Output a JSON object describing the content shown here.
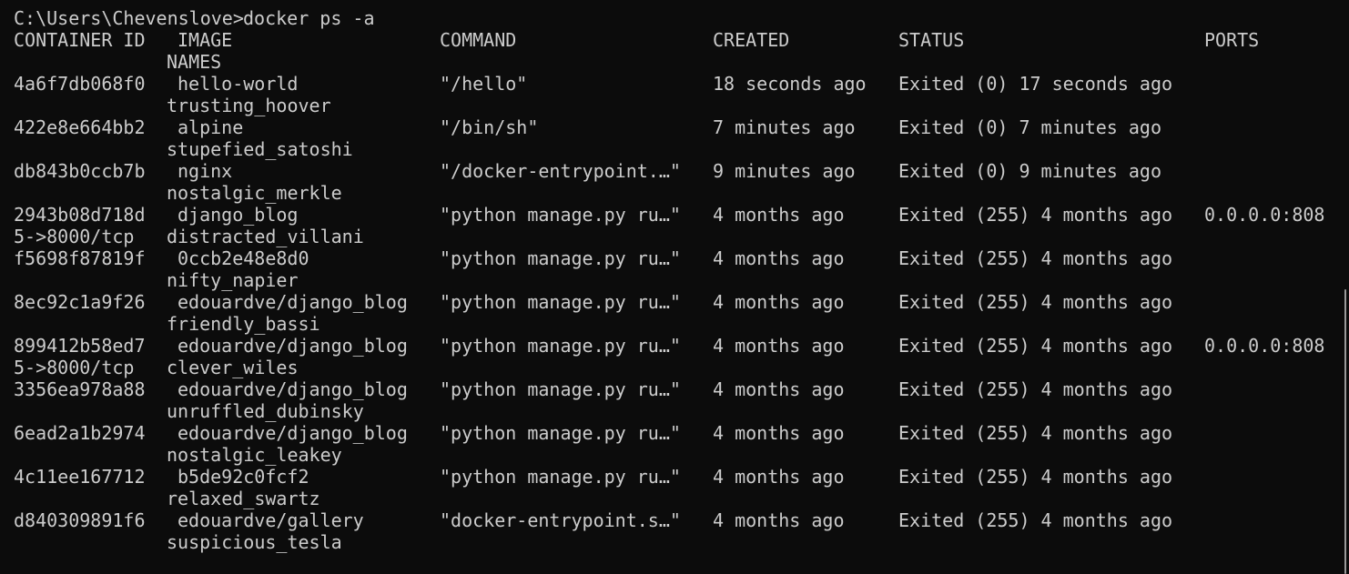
{
  "prompt": {
    "path": "C:\\Users\\Chevenslove>",
    "command": "docker ps -a"
  },
  "headers": {
    "container_id": "CONTAINER ID",
    "image": "IMAGE",
    "command": "COMMAND",
    "created": "CREATED",
    "status": "STATUS",
    "ports": "PORTS",
    "names": "NAMES"
  },
  "rows": [
    {
      "id": "4a6f7db068f0",
      "image": "hello-world",
      "command": "\"/hello\"",
      "created": "18 seconds ago",
      "status": "Exited (0) 17 seconds ago",
      "ports": "",
      "ports_wrap": "",
      "name": "trusting_hoover"
    },
    {
      "id": "422e8e664bb2",
      "image": "alpine",
      "command": "\"/bin/sh\"",
      "created": "7 minutes ago",
      "status": "Exited (0) 7 minutes ago",
      "ports": "",
      "ports_wrap": "",
      "name": "stupefied_satoshi"
    },
    {
      "id": "db843b0ccb7b",
      "image": "nginx",
      "command": "\"/docker-entrypoint.…\"",
      "created": "9 minutes ago",
      "status": "Exited (0) 9 minutes ago",
      "ports": "",
      "ports_wrap": "",
      "name": "nostalgic_merkle"
    },
    {
      "id": "2943b08d718d",
      "image": "django_blog",
      "command": "\"python manage.py ru…\"",
      "created": "4 months ago",
      "status": "Exited (255) 4 months ago",
      "ports": "0.0.0.0:808",
      "ports_wrap": "5->8000/tcp",
      "name": "distracted_villani"
    },
    {
      "id": "f5698f87819f",
      "image": "0ccb2e48e8d0",
      "command": "\"python manage.py ru…\"",
      "created": "4 months ago",
      "status": "Exited (255) 4 months ago",
      "ports": "",
      "ports_wrap": "",
      "name": "nifty_napier"
    },
    {
      "id": "8ec92c1a9f26",
      "image": "edouardve/django_blog",
      "command": "\"python manage.py ru…\"",
      "created": "4 months ago",
      "status": "Exited (255) 4 months ago",
      "ports": "",
      "ports_wrap": "",
      "name": "friendly_bassi"
    },
    {
      "id": "899412b58ed7",
      "image": "edouardve/django_blog",
      "command": "\"python manage.py ru…\"",
      "created": "4 months ago",
      "status": "Exited (255) 4 months ago",
      "ports": "0.0.0.0:808",
      "ports_wrap": "5->8000/tcp",
      "name": "clever_wiles"
    },
    {
      "id": "3356ea978a88",
      "image": "edouardve/django_blog",
      "command": "\"python manage.py ru…\"",
      "created": "4 months ago",
      "status": "Exited (255) 4 months ago",
      "ports": "",
      "ports_wrap": "",
      "name": "unruffled_dubinsky"
    },
    {
      "id": "6ead2a1b2974",
      "image": "edouardve/django_blog",
      "command": "\"python manage.py ru…\"",
      "created": "4 months ago",
      "status": "Exited (255) 4 months ago",
      "ports": "",
      "ports_wrap": "",
      "name": "nostalgic_leakey"
    },
    {
      "id": "4c11ee167712",
      "image": "b5de92c0fcf2",
      "command": "\"python manage.py ru…\"",
      "created": "4 months ago",
      "status": "Exited (255) 4 months ago",
      "ports": "",
      "ports_wrap": "",
      "name": "relaxed_swartz"
    },
    {
      "id": "d840309891f6",
      "image": "edouardve/gallery",
      "command": "\"docker-entrypoint.s…\"",
      "created": "4 months ago",
      "status": "Exited (255) 4 months ago",
      "ports": "",
      "ports_wrap": "",
      "name": "suspicious_tesla"
    }
  ],
  "colors": {
    "background": "#0c0c0c",
    "foreground": "#cccccc"
  }
}
